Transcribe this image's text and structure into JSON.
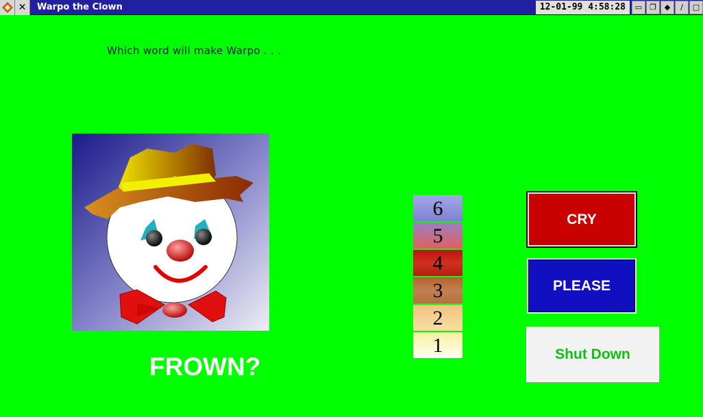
{
  "window": {
    "title": "Warpo the Clown",
    "date_time": "12-01-99  4:58:28",
    "system_menu_icon": "diamond-icon",
    "close_icon": "close-icon"
  },
  "question": "Which word will make Warpo . . .",
  "target_word": "FROWN?",
  "scale": {
    "levels": [
      "6",
      "5",
      "4",
      "3",
      "2",
      "1"
    ]
  },
  "buttons": {
    "cry": "CRY",
    "please": "PLEASE",
    "shutdown": "Shut Down"
  },
  "colors": {
    "background": "#00ff00",
    "cry": "#c80000",
    "please": "#1010c0",
    "shutdown_text": "#10c010"
  }
}
